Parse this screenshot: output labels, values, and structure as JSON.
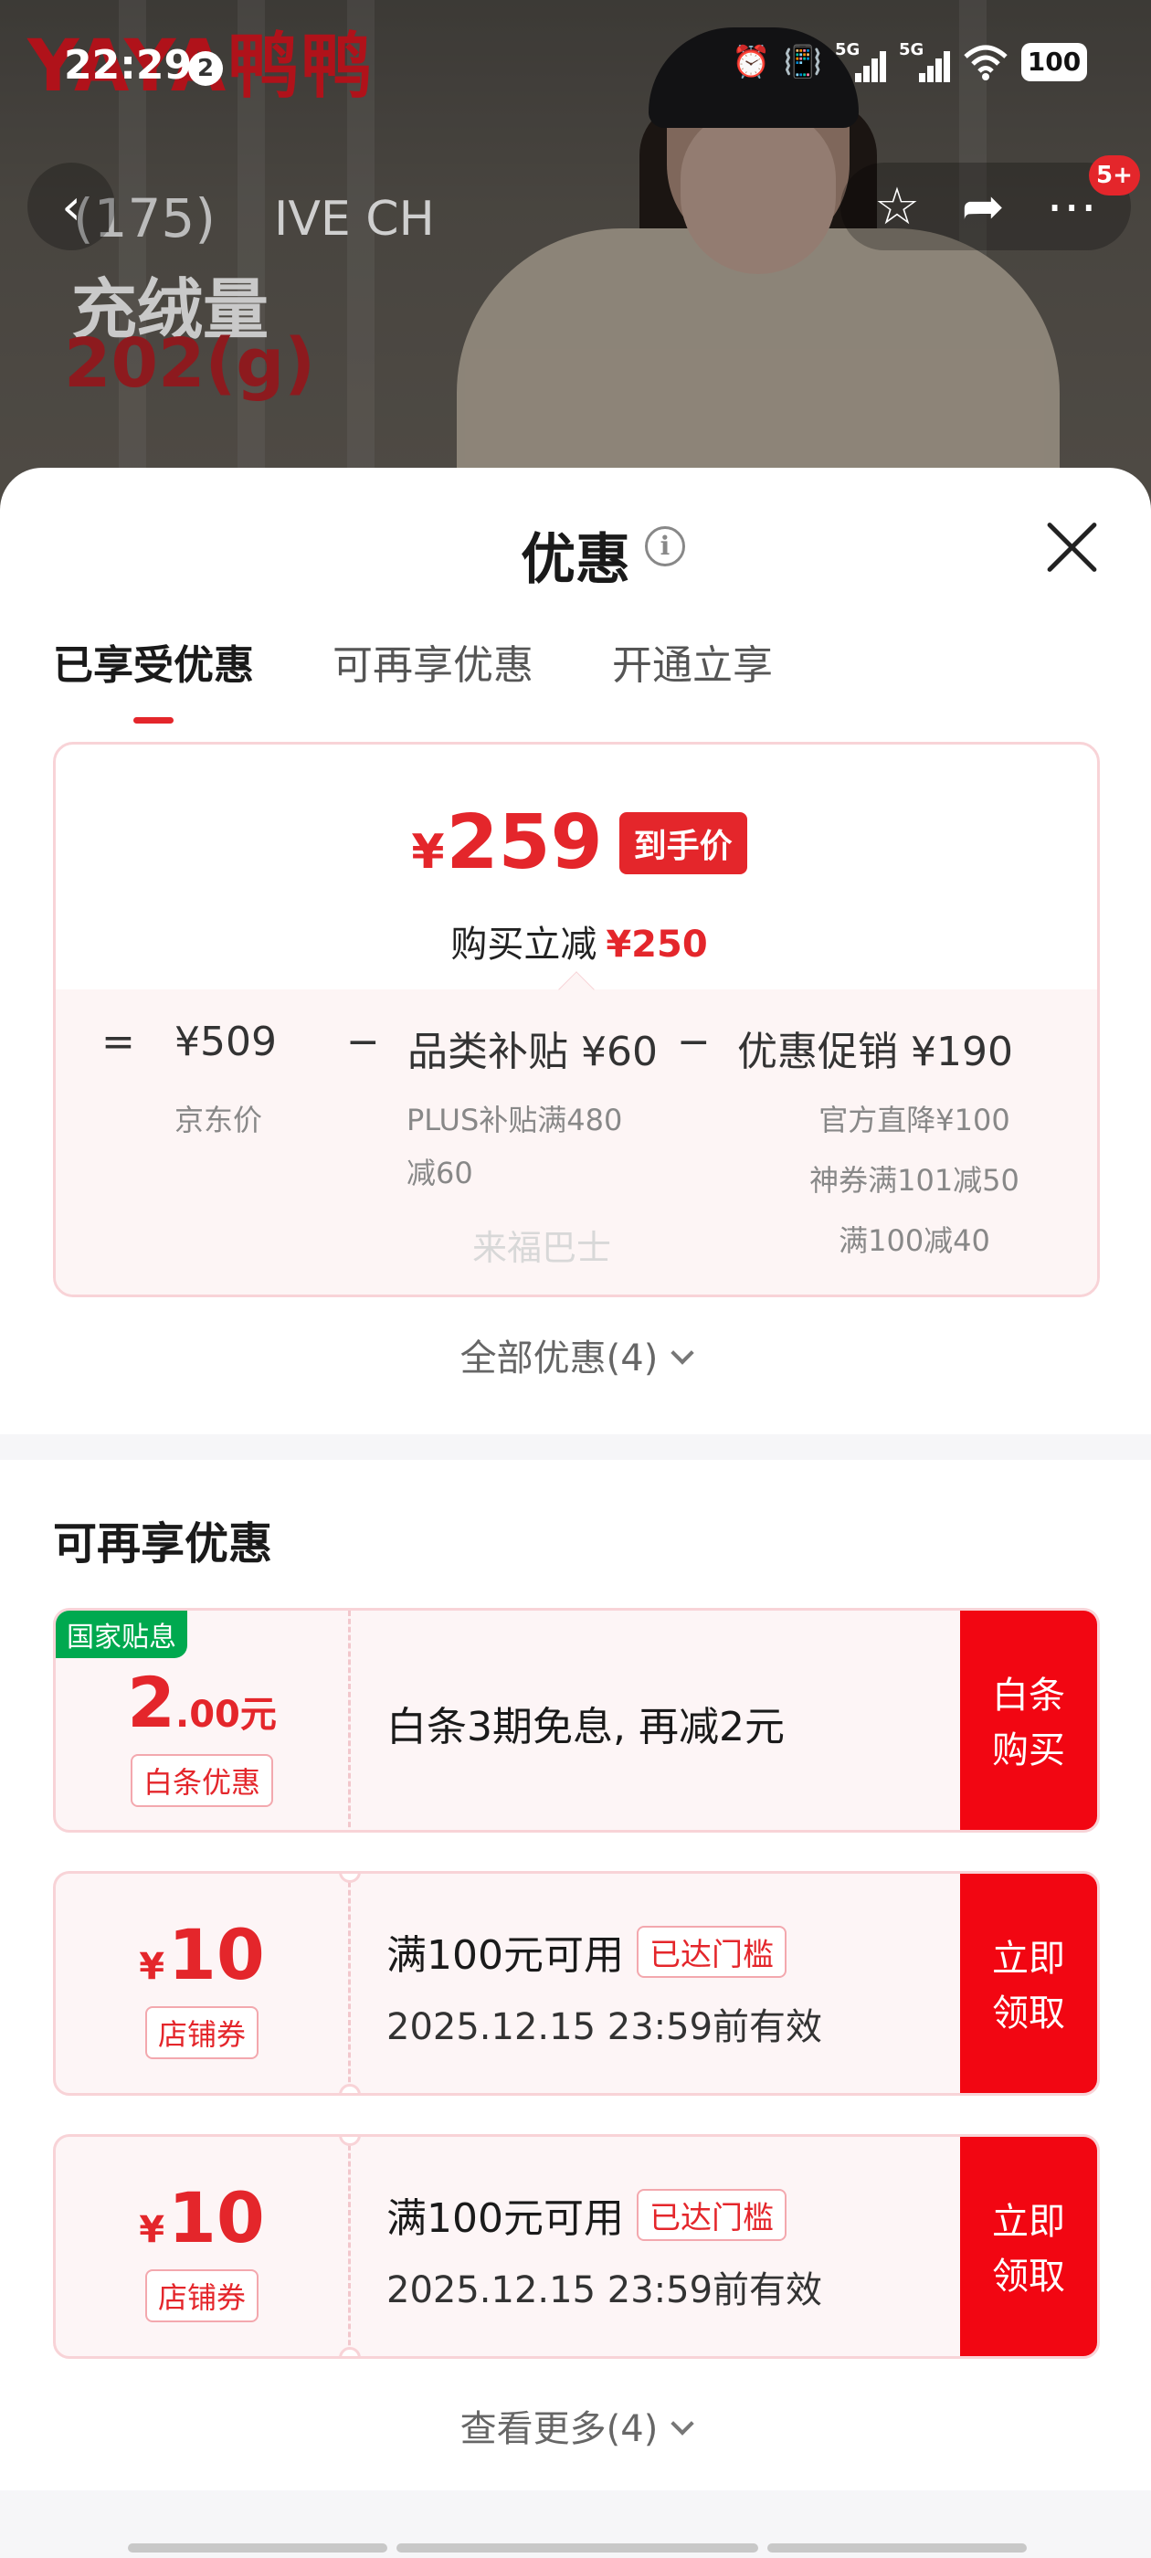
{
  "status_bar": {
    "time": "22:29",
    "notification_count": "2",
    "signal_1": "5G",
    "signal_2": "5G",
    "battery": "100"
  },
  "hero": {
    "brand": "YAYA鸭鸭",
    "promo_line1": "(175)",
    "store_text": "IVE CH",
    "promo_line2": "充绒量",
    "promo_line3": "202(g)",
    "more_badge": "5+"
  },
  "sheet": {
    "title": "优惠",
    "tabs": [
      {
        "label": "已享受优惠",
        "active": true
      },
      {
        "label": "可再享优惠",
        "active": false
      },
      {
        "label": "开通立享",
        "active": false
      }
    ]
  },
  "summary": {
    "currency": "¥",
    "final_price": "259",
    "final_price_tag": "到手价",
    "reduce_label": "购买立减",
    "reduce_amount": "¥250",
    "formula": {
      "eq": "=",
      "jd_price": "¥509",
      "minus1": "−",
      "category_subsidy": "品类补贴 ¥60",
      "minus2": "−",
      "promo": "优惠促销 ¥190"
    },
    "notes": {
      "jd_price_label": "京东价",
      "subsidy_line1": "PLUS补贴满480",
      "subsidy_line2": "减60",
      "promo_line1": "官方直降¥100",
      "promo_line2": "神券满101减50",
      "promo_line3": "满100减40"
    },
    "watermark": "来福巴士",
    "all_link": "全部优惠(4)"
  },
  "more_offers": {
    "title": "可再享优惠",
    "coupons": [
      {
        "tag": "国家贴息",
        "amount_int": "2",
        "amount_dec": ".00元",
        "label": "白条优惠",
        "desc": "白条3期免息, 再减2元",
        "cta_line1": "白条",
        "cta_line2": "购买"
      },
      {
        "currency": "¥",
        "amount": "10",
        "label": "店铺券",
        "desc": "满100元可用",
        "status": "已达门槛",
        "validity": "2025.12.15 23:59前有效",
        "cta_line1": "立即",
        "cta_line2": "领取"
      },
      {
        "currency": "¥",
        "amount": "10",
        "label": "店铺券",
        "desc": "满100元可用",
        "status": "已达门槛",
        "validity": "2025.12.15 23:59前有效",
        "cta_line1": "立即",
        "cta_line2": "领取"
      }
    ],
    "more_link": "查看更多(4)"
  },
  "colors": {
    "accent_red": "#e4262b",
    "cta_red": "#f20612",
    "gov_green": "#00a94f"
  }
}
